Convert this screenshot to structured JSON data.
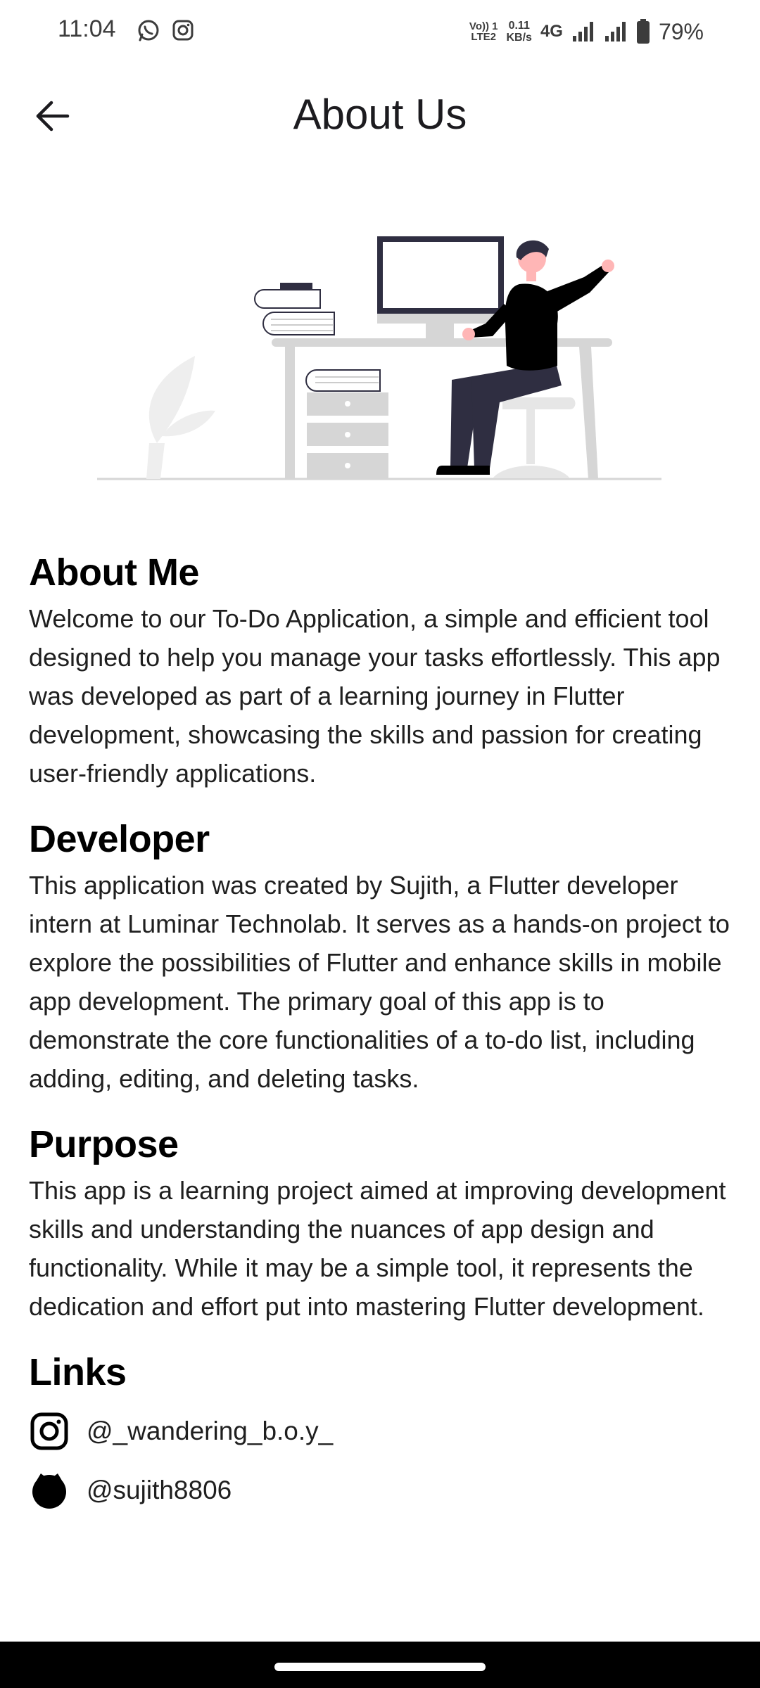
{
  "status_bar": {
    "time": "11:04",
    "volte_line1": "Vo)) 1",
    "volte_line2": "LTE2",
    "speed_value": "0.11",
    "speed_unit": "KB/s",
    "network": "4G",
    "battery": "79%",
    "icons": [
      "whatsapp-icon",
      "instagram-icon",
      "signal-icon",
      "signal-icon",
      "battery-icon"
    ]
  },
  "app_bar": {
    "title": "About Us",
    "back_icon": "arrow-left-icon"
  },
  "sections": {
    "about": {
      "heading": "About Me",
      "body": "Welcome to our To-Do Application, a simple and efficient tool designed to help you manage your tasks effortlessly. This app was developed as part of a learning journey in Flutter development, showcasing the skills and passion for creating user-friendly applications."
    },
    "developer": {
      "heading": "Developer",
      "body": "This application was created by Sujith, a Flutter developer intern at Luminar Technolab. It serves as a hands-on project to explore the possibilities of Flutter and enhance skills in mobile app development. The primary goal of this app is to demonstrate the core functionalities of a to-do list, including adding, editing, and deleting tasks."
    },
    "purpose": {
      "heading": "Purpose",
      "body": "This app is a learning project aimed at improving development skills and understanding the nuances of app design and functionality. While it may be a simple tool, it represents the dedication and effort put into mastering Flutter development."
    },
    "links": {
      "heading": "Links",
      "items": [
        {
          "icon": "instagram-icon",
          "text": "@_wandering_b.o.y_"
        },
        {
          "icon": "github-icon",
          "text": "@sujith8806"
        }
      ]
    }
  },
  "colors": {
    "background": "#ffffff",
    "text": "#1f1f1f",
    "heading": "#000000",
    "illustration_dark": "#2f2e41",
    "illustration_gray": "#d6d6d6",
    "skin": "#ffb6b6"
  }
}
